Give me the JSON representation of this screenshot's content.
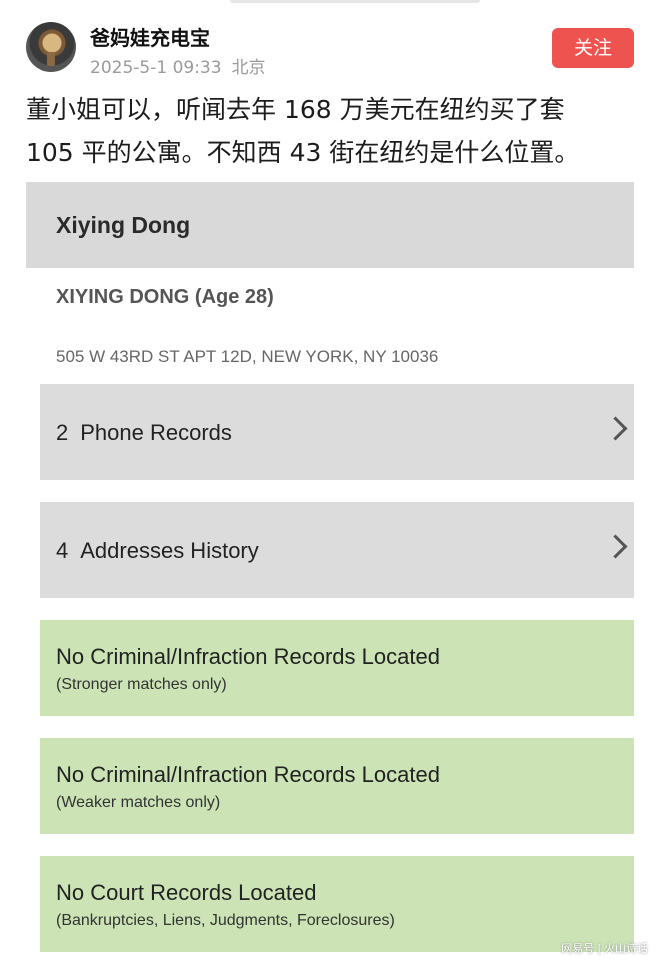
{
  "post": {
    "username": "爸妈娃充电宝",
    "timestamp": "2025-5-1 09:33",
    "location": "北京",
    "follow_label": "关注",
    "text_lines": [
      "董小姐可以，听闻去年 168 万美元在纽约买了套",
      "105 平的公寓。不知西 43 街在纽约是什么位置。"
    ]
  },
  "record": {
    "header_name": "Xiying Dong",
    "full_name": "XIYING DONG (Age 28)",
    "address": "505 W 43RD ST APT 12D, NEW YORK, NY 10036",
    "rows": [
      {
        "count": "2",
        "label": "Phone Records"
      },
      {
        "count": "4",
        "label": "Addresses History"
      }
    ],
    "statuses": [
      {
        "title": "No Criminal/Infraction Records Located",
        "sub": "(Stronger matches only)"
      },
      {
        "title": "No Criminal/Infraction Records Located",
        "sub": "(Weaker matches only)"
      },
      {
        "title": "No Court Records Located",
        "sub": "(Bankruptcies, Liens, Judgments, Foreclosures)"
      }
    ]
  },
  "watermark": {
    "left": "网易号",
    "right": "火山诗话"
  },
  "colors": {
    "follow": "#ef5350",
    "gray_row": "#dcdcdc",
    "green_row": "#cbe3b5"
  }
}
